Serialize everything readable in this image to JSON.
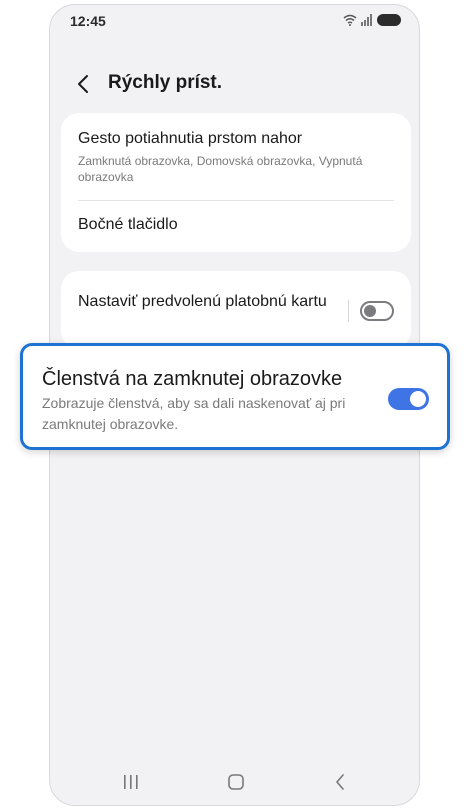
{
  "status_bar": {
    "time": "12:45"
  },
  "header": {
    "title": "Rýchly príst."
  },
  "settings_group_1": {
    "items": [
      {
        "title": "Gesto potiahnutia prstom nahor",
        "subtitle": "Zamknutá obrazovka, Domovská obrazovka, Vypnutá obrazovka"
      },
      {
        "title": "Bočné tlačidlo"
      }
    ]
  },
  "settings_group_2": {
    "items": [
      {
        "title": "Nastaviť predvolenú platobnú kartu",
        "toggle_on": false
      }
    ]
  },
  "highlighted_item": {
    "title": "Členstvá na zamknutej obrazovke",
    "description": "Zobrazuje členstvá, aby sa dali naskenovať aj pri zamknutej obrazovke.",
    "toggle_on": true
  },
  "colors": {
    "accent": "#3e74e6",
    "highlight_border": "#1d73d4",
    "background": "#f2f2f4"
  },
  "icons": {
    "back": "chevron-left-icon",
    "nav_recents": "recents-icon",
    "nav_home": "home-icon",
    "nav_back": "back-icon"
  }
}
